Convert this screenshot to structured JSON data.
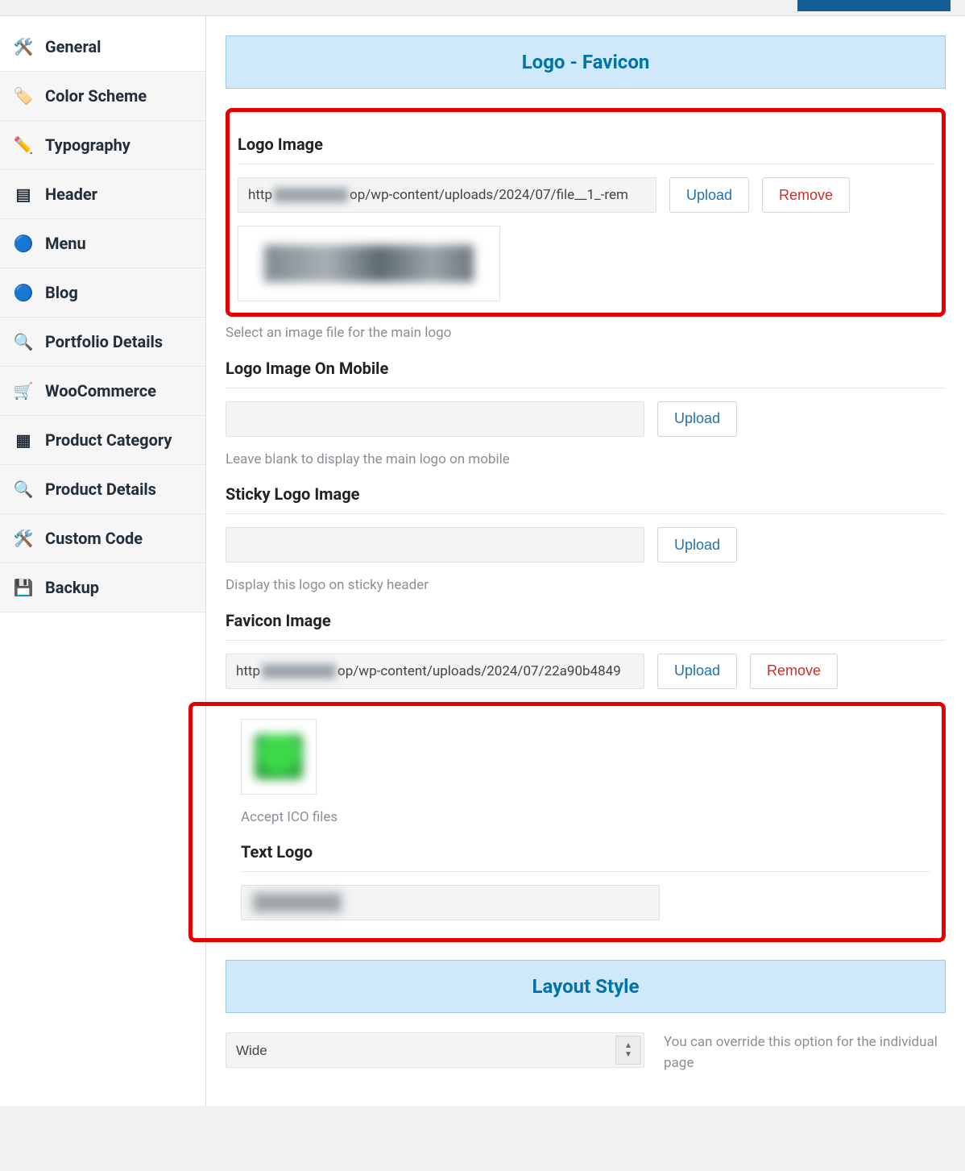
{
  "sidebar": {
    "items": [
      {
        "label": "General",
        "icon": "🛠️"
      },
      {
        "label": "Color Scheme",
        "icon": "🏷️"
      },
      {
        "label": "Typography",
        "icon": "✏️"
      },
      {
        "label": "Header",
        "icon": "▤"
      },
      {
        "label": "Menu",
        "icon": "🔵"
      },
      {
        "label": "Blog",
        "icon": "🔵"
      },
      {
        "label": "Portfolio Details",
        "icon": "🔍"
      },
      {
        "label": "WooCommerce",
        "icon": "🛒"
      },
      {
        "label": "Product Category",
        "icon": "▦"
      },
      {
        "label": "Product Details",
        "icon": "🔍"
      },
      {
        "label": "Custom Code",
        "icon": "🛠️"
      },
      {
        "label": "Backup",
        "icon": "💾"
      }
    ]
  },
  "sections": {
    "logo_favicon": "Logo - Favicon",
    "layout_style": "Layout Style"
  },
  "fields": {
    "logo_image": {
      "label": "Logo Image",
      "url_prefix": "http",
      "url_suffix": "op/wp-content/uploads/2024/07/file__1_-rem",
      "upload": "Upload",
      "remove": "Remove",
      "desc": "Select an image file for the main logo"
    },
    "logo_mobile": {
      "label": "Logo Image On Mobile",
      "value": "",
      "upload": "Upload",
      "desc": "Leave blank to display the main logo on mobile"
    },
    "sticky_logo": {
      "label": "Sticky Logo Image",
      "value": "",
      "upload": "Upload",
      "desc": "Display this logo on sticky header"
    },
    "favicon": {
      "label": "Favicon Image",
      "url_prefix": "http",
      "url_suffix": "op/wp-content/uploads/2024/07/22a90b4849",
      "upload": "Upload",
      "remove": "Remove",
      "desc": "Accept ICO files"
    },
    "text_logo": {
      "label": "Text Logo",
      "value": ""
    },
    "layout": {
      "selected": "Wide",
      "desc": "You can override this option for the individual page"
    }
  }
}
